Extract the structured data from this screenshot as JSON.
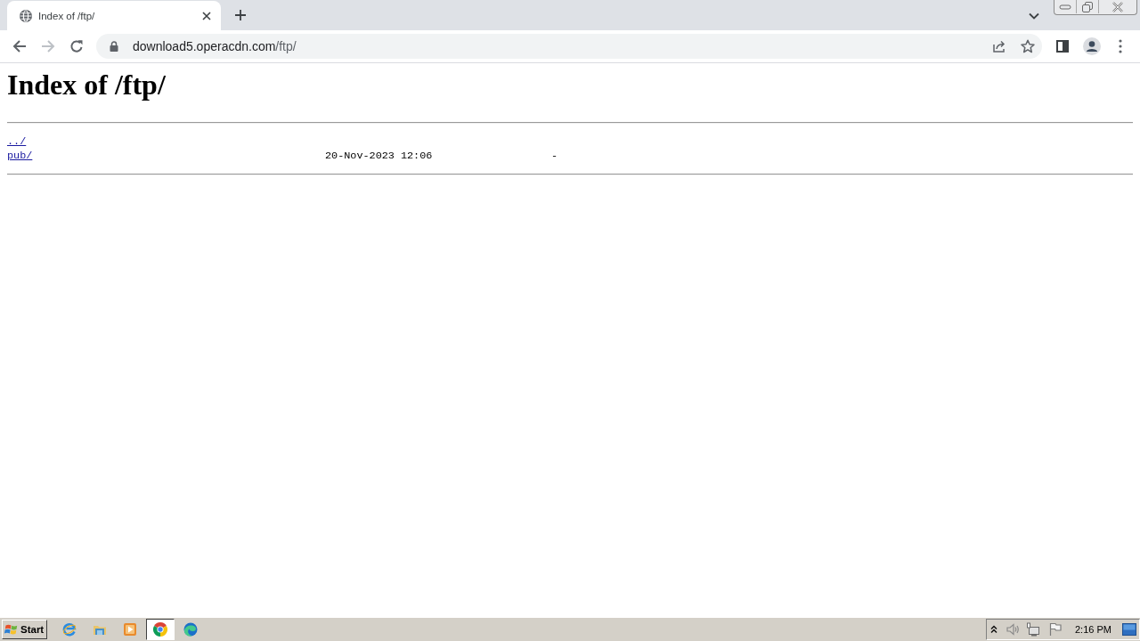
{
  "tabs": [
    {
      "title": "Index of /ftp/",
      "selected": true
    }
  ],
  "toolbar": {
    "back": {
      "disabled": false
    },
    "forward": {
      "disabled": true
    },
    "url_host": "download5.operacdn.com",
    "url_path": "/ftp/"
  },
  "page": {
    "heading": "Index of /ftp/",
    "entries": [
      {
        "name": "../"
      },
      {
        "name": "pub/",
        "date": "20-Nov-2023 12:06",
        "size": "-"
      }
    ]
  },
  "taskbar": {
    "start": "Start",
    "apps": [
      {
        "kind": "ie",
        "selected": false
      },
      {
        "kind": "folder",
        "selected": false
      },
      {
        "kind": "player",
        "selected": false
      },
      {
        "kind": "chrome",
        "selected": true
      },
      {
        "kind": "edge",
        "selected": false
      }
    ],
    "clock": "2:16 PM"
  }
}
